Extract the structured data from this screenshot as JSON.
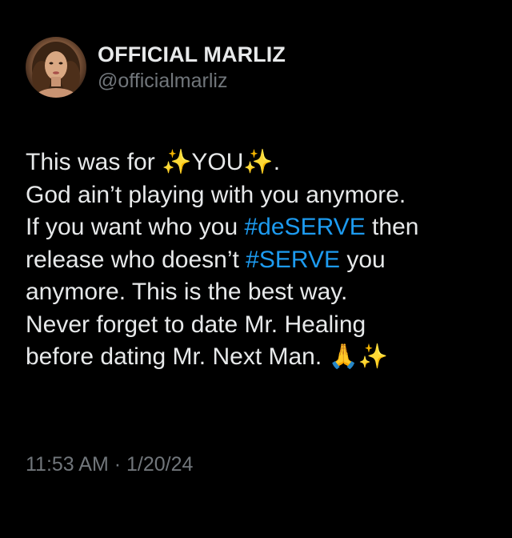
{
  "author": {
    "display_name": "OFFICIAL MARLIZ",
    "handle": "@officialmarliz",
    "avatar_icon": "profile-photo"
  },
  "tweet": {
    "l1_a": "This was for ",
    "l1_sparkle_1": "✨",
    "l1_b": "YOU",
    "l1_sparkle_2": "✨",
    "l1_c": ".",
    "l2": "God ain’t playing with you anymore.",
    "l3_a": "If you want who you ",
    "l3_hashtag": "#deSERVE",
    "l3_b": " then",
    "l4_a": "release who doesn’t ",
    "l4_hashtag": "#SERVE",
    "l4_b": " you",
    "l5": "anymore. This is the best way.",
    "l6": "Never forget to date Mr. Healing",
    "l7_a": "before dating Mr. Next Man. ",
    "l7_pray": "🙏",
    "l7_sparkle": "✨"
  },
  "meta": {
    "timestamp": "11:53 AM · 1/20/24"
  },
  "colors": {
    "background": "#000000",
    "text": "#e7e9ea",
    "secondary": "#71767b",
    "hashtag": "#1d9bf0"
  }
}
